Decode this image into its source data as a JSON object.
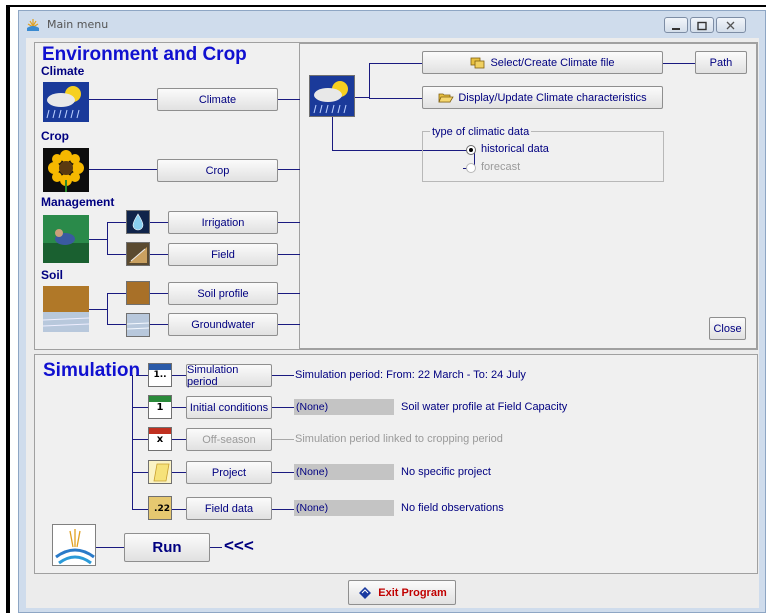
{
  "window": {
    "title": "Main menu"
  },
  "environment": {
    "heading": "Environment and Crop",
    "climate_label": "Climate",
    "crop_label": "Crop",
    "management_label": "Management",
    "soil_label": "Soil",
    "climate_button": "Climate",
    "crop_button": "Crop",
    "irrigation_button": "Irrigation",
    "field_button": "Field",
    "soil_profile_button": "Soil profile",
    "groundwater_button": "Groundwater"
  },
  "climate_panel": {
    "select_button": "Select/Create Climate file",
    "path_button": "Path",
    "display_button": "Display/Update Climate characteristics",
    "group_title": "type of climatic data",
    "option_historical": "historical data",
    "option_forecast": "forecast",
    "historical_selected": true,
    "close_button": "Close"
  },
  "simulation": {
    "heading": "Simulation",
    "period_icon_text": "1..",
    "initial_icon_text": "1",
    "offseason_icon_text": "x",
    "fielddata_icon_text": ".22",
    "period_button": "Simulation period",
    "period_text": "Simulation period: From: 22 March - To: 24 July",
    "initial_button": "Initial conditions",
    "initial_value": "(None)",
    "initial_text": "Soil water profile at Field Capacity",
    "offseason_button": "Off-season",
    "offseason_text": "Simulation period linked to cropping period",
    "project_button": "Project",
    "project_value": "(None)",
    "project_text": "No specific project",
    "fielddata_button": "Field data",
    "fielddata_value": "(None)",
    "fielddata_text": "No field observations",
    "run_button": "Run",
    "run_arrows": "<<<"
  },
  "footer": {
    "exit_button": "Exit Program"
  },
  "colors": {
    "heading": "#1010d0",
    "text": "#000080",
    "exit": "#c00000"
  }
}
